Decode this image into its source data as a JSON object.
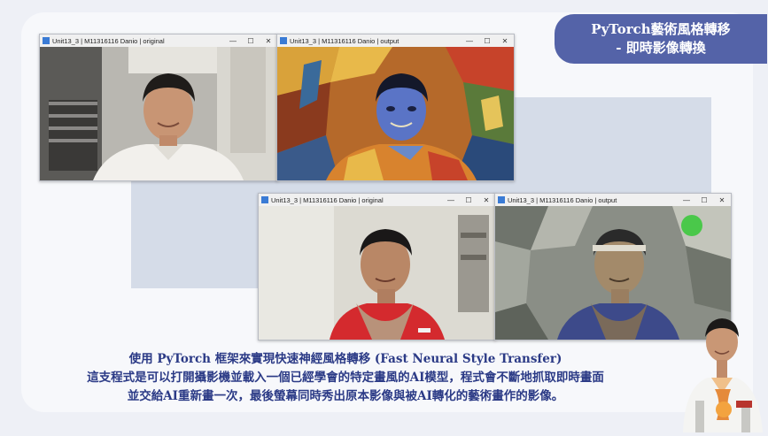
{
  "banner": {
    "line1": "PyTorch藝術風格轉移",
    "line2": "- 即時影像轉換"
  },
  "windows": [
    {
      "title": "Unit13_3 | M11316116 Danio  | original",
      "kind": "original-office"
    },
    {
      "title": "Unit13_3 | M11316116 Danio  | output",
      "kind": "stylized-office"
    },
    {
      "title": "Unit13_3 | M11316116 Danio  | original",
      "kind": "original-red"
    },
    {
      "title": "Unit13_3 | M11316116 Danio  | output",
      "kind": "stylized-red"
    }
  ],
  "window_controls": {
    "minimize": "—",
    "maximize": "☐",
    "close": "✕"
  },
  "caption": {
    "line1": "使用 PyTorch 框架來實現快速神經風格轉移 (Fast Neural Style Transfer)",
    "line2": "這支程式是可以打開攝影機並載入一個已經學會的特定畫風的AI模型，程式會不斷地抓取即時畫面",
    "line3": "並交給AI重新畫一次，最後螢幕同時秀出原本影像與被AI轉化的藝術畫作的影像。"
  },
  "colors": {
    "banner": "#5463a8",
    "caption_text": "#2b3a86",
    "accent_block": "#d5dce8"
  }
}
